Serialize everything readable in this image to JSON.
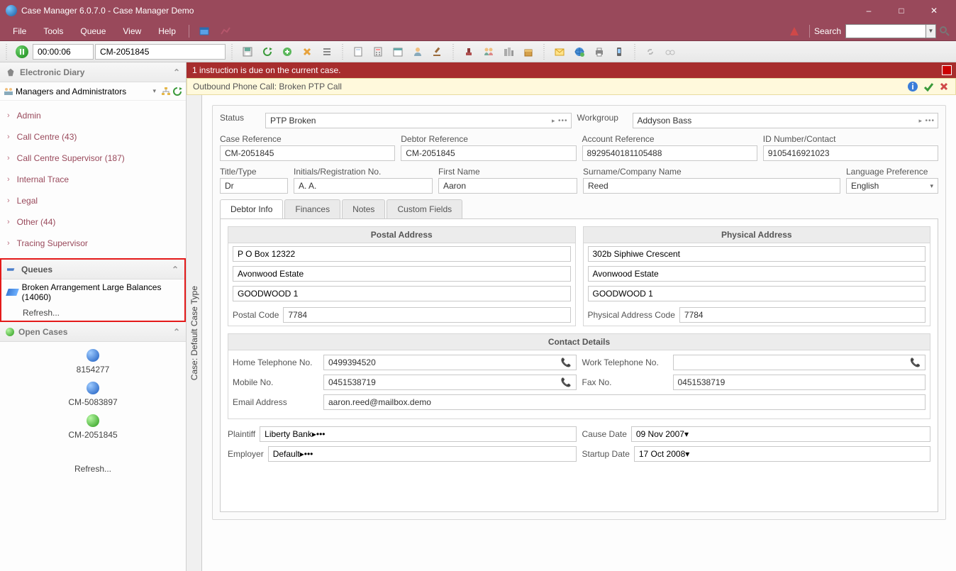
{
  "window": {
    "title": "Case Manager 6.0.7.0 - Case Manager Demo"
  },
  "menu": {
    "file": "File",
    "tools": "Tools",
    "queue": "Queue",
    "view": "View",
    "help": "Help",
    "search_label": "Search"
  },
  "timer": {
    "elapsed": "00:00:06",
    "case_ref": "CM-2051845"
  },
  "sidebar": {
    "diary_title": "Electronic Diary",
    "role_select": "Managers and Administrators",
    "tree": [
      {
        "label": "Admin"
      },
      {
        "label": "Call Centre (43)"
      },
      {
        "label": "Call Centre Supervisor (187)"
      },
      {
        "label": "Internal Trace"
      },
      {
        "label": "Legal"
      },
      {
        "label": "Other (44)"
      },
      {
        "label": "Tracing Supervisor"
      }
    ],
    "queues": {
      "title": "Queues",
      "items": [
        {
          "label": "Broken Arrangement Large Balances (14060)"
        }
      ],
      "refresh": "Refresh..."
    },
    "open_cases": {
      "title": "Open Cases",
      "items": [
        {
          "label": "8154277",
          "color": "blue"
        },
        {
          "label": "CM-5083897",
          "color": "blue"
        },
        {
          "label": "CM-2051845",
          "color": "green"
        }
      ],
      "refresh": "Refresh..."
    }
  },
  "vtab": "Case: Default Case Type",
  "alerts": {
    "red": "1 instruction is due on the current case.",
    "yellow": "Outbound Phone Call: Broken PTP Call"
  },
  "form": {
    "status_lbl": "Status",
    "status_val": "PTP Broken",
    "workgroup_lbl": "Workgroup",
    "workgroup_val": "Addyson Bass",
    "case_ref_lbl": "Case Reference",
    "case_ref_val": "CM-2051845",
    "debtor_ref_lbl": "Debtor Reference",
    "debtor_ref_val": "CM-2051845",
    "acct_ref_lbl": "Account Reference",
    "acct_ref_val": "8929540181105488",
    "id_lbl": "ID Number/Contact",
    "id_val": "9105416921023",
    "title_lbl": "Title/Type",
    "title_val": "Dr",
    "initials_lbl": "Initials/Registration No.",
    "initials_val": "A. A.",
    "fname_lbl": "First Name",
    "fname_val": "Aaron",
    "surname_lbl": "Surname/Company Name",
    "surname_val": "Reed",
    "lang_lbl": "Language Preference",
    "lang_val": "English"
  },
  "tabs": {
    "t0": "Debtor Info",
    "t1": "Finances",
    "t2": "Notes",
    "t3": "Custom Fields"
  },
  "debtor": {
    "postal_hdr": "Postal Address",
    "postal": {
      "l1": "P O Box 12322",
      "l2": "Avonwood Estate",
      "l3": "GOODWOOD 1",
      "pc_lbl": "Postal Code",
      "pc": "7784"
    },
    "physical_hdr": "Physical Address",
    "physical": {
      "l1": "302b Siphiwe Crescent",
      "l2": "Avonwood Estate",
      "l3": "GOODWOOD 1",
      "pc_lbl": "Physical Address Code",
      "pc": "7784"
    },
    "contact_hdr": "Contact Details",
    "contact": {
      "home_lbl": "Home Telephone No.",
      "home": "0499394520",
      "work_lbl": "Work Telephone No.",
      "work": "",
      "mobile_lbl": "Mobile No.",
      "mobile": "0451538719",
      "fax_lbl": "Fax No.",
      "fax": "0451538719",
      "email_lbl": "Email Address",
      "email": "aaron.reed@mailbox.demo"
    },
    "plaintiff_lbl": "Plaintiff",
    "plaintiff": "Liberty Bank",
    "cause_lbl": "Cause Date",
    "cause": "09 Nov 2007",
    "employer_lbl": "Employer",
    "employer": "Default",
    "startup_lbl": "Startup Date",
    "startup": "17 Oct 2008"
  }
}
